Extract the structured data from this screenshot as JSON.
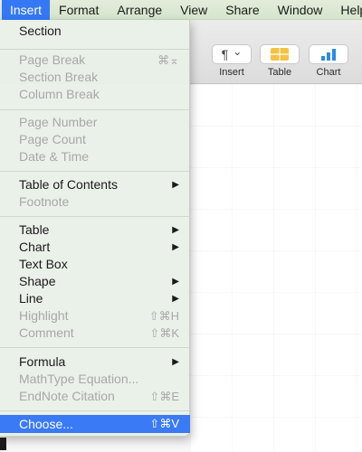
{
  "menubar": {
    "items": [
      {
        "label": "Insert"
      },
      {
        "label": "Format"
      },
      {
        "label": "Arrange"
      },
      {
        "label": "View"
      },
      {
        "label": "Share"
      },
      {
        "label": "Window"
      },
      {
        "label": "Help"
      }
    ]
  },
  "toolbar": {
    "insert": {
      "label": "Insert",
      "icon": "paragraph-icon",
      "glyph": "¶",
      "chevron": "⌄"
    },
    "table": {
      "label": "Table",
      "icon": "table-icon",
      "color": "#f5c242"
    },
    "chart": {
      "label": "Chart",
      "icon": "chart-icon",
      "color": "#2b8ce6"
    }
  },
  "insert_menu": {
    "section": {
      "label": "Section"
    },
    "page_break": {
      "label": "Page Break",
      "shortcut": "⌘⌅"
    },
    "section_break": {
      "label": "Section Break"
    },
    "column_break": {
      "label": "Column Break"
    },
    "page_number": {
      "label": "Page Number"
    },
    "page_count": {
      "label": "Page Count"
    },
    "date_time": {
      "label": "Date & Time"
    },
    "table_of_contents": {
      "label": "Table of Contents"
    },
    "footnote": {
      "label": "Footnote"
    },
    "table": {
      "label": "Table"
    },
    "chart": {
      "label": "Chart"
    },
    "text_box": {
      "label": "Text Box"
    },
    "shape": {
      "label": "Shape"
    },
    "line": {
      "label": "Line"
    },
    "highlight": {
      "label": "Highlight",
      "shortcut": "⇧⌘H"
    },
    "comment": {
      "label": "Comment",
      "shortcut": "⇧⌘K"
    },
    "formula": {
      "label": "Formula"
    },
    "mathtype": {
      "label": "MathType Equation..."
    },
    "endnote": {
      "label": "EndNote Citation",
      "shortcut": "⇧⌘E"
    },
    "choose": {
      "label": "Choose...",
      "shortcut": "⇧⌘V"
    },
    "submenu_arrow": "▶"
  }
}
